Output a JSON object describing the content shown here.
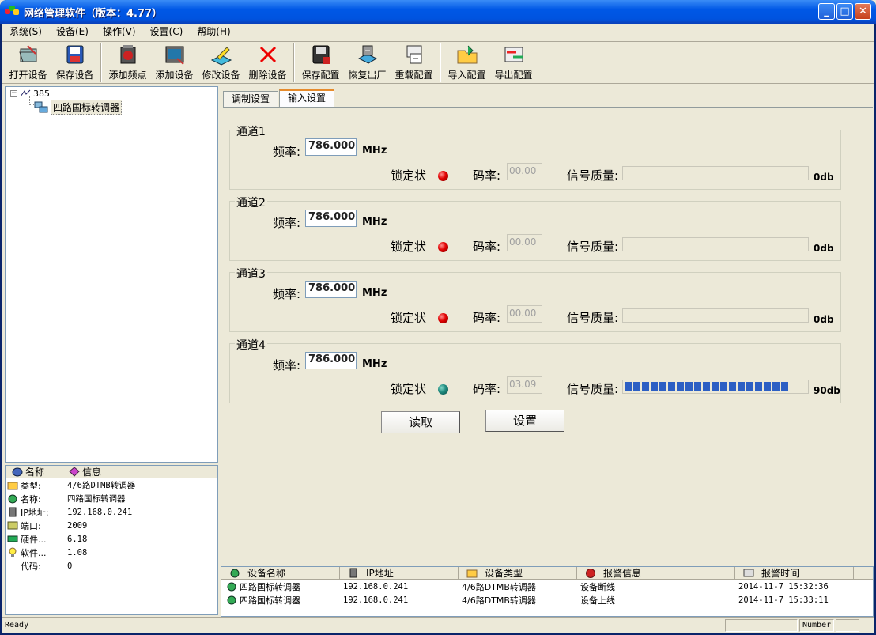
{
  "window": {
    "title": "网络管理软件（版本：4.77）"
  },
  "menu": [
    "系统(S)",
    "设备(E)",
    "操作(V)",
    "设置(C)",
    "帮助(H)"
  ],
  "toolbar": {
    "open_device": "打开设备",
    "save_device": "保存设备",
    "add_freq": "添加频点",
    "add_device": "添加设备",
    "edit_device": "修改设备",
    "delete_device": "删除设备",
    "save_config": "保存配置",
    "factory_reset": "恢复出厂",
    "reload_config": "重载配置",
    "import_config": "导入配置",
    "export_config": "导出配置"
  },
  "tree": {
    "root": "385",
    "child": "四路国标转调器"
  },
  "info": {
    "headers": [
      "名称",
      "信息"
    ],
    "rows": [
      {
        "k": "类型:",
        "v": "4/6路DTMB转调器"
      },
      {
        "k": "名称:",
        "v": "四路国标转调器"
      },
      {
        "k": "IP地址:",
        "v": "192.168.0.241"
      },
      {
        "k": "端口:",
        "v": "2009"
      },
      {
        "k": "硬件...",
        "v": "6.18"
      },
      {
        "k": "软件...",
        "v": "1.08"
      },
      {
        "k": "代码:",
        "v": "0"
      }
    ]
  },
  "tabs": [
    "调制设置",
    "输入设置"
  ],
  "labels": {
    "freq": "频率:",
    "unit": "MHz",
    "lock": "锁定状",
    "rate": "码率:",
    "quality": "信号质量:"
  },
  "channels": [
    {
      "name": "通道1",
      "freq": "786.000",
      "rate": "00.00",
      "quality": "0db",
      "quality_pct": 0,
      "locked": false
    },
    {
      "name": "通道2",
      "freq": "786.000",
      "rate": "00.00",
      "quality": "0db",
      "quality_pct": 0,
      "locked": false
    },
    {
      "name": "通道3",
      "freq": "786.000",
      "rate": "00.00",
      "quality": "0db",
      "quality_pct": 0,
      "locked": false
    },
    {
      "name": "通道4",
      "freq": "786.000",
      "rate": "03.09",
      "quality": "90db",
      "quality_pct": 90,
      "locked": true
    }
  ],
  "actions": {
    "read": "读取",
    "set": "设置"
  },
  "alarms": {
    "headers": [
      "设备名称",
      "IP地址",
      "设备类型",
      "报警信息",
      "报警时间"
    ],
    "rows": [
      [
        "四路国标转调器",
        "192.168.0.241",
        "4/6路DTMB转调器",
        "设备断线",
        "2014-11-7 15:32:36"
      ],
      [
        "四路国标转调器",
        "192.168.0.241",
        "4/6路DTMB转调器",
        "设备上线",
        "2014-11-7 15:33:11"
      ]
    ]
  },
  "status": {
    "text": "Ready",
    "number": "Number"
  }
}
